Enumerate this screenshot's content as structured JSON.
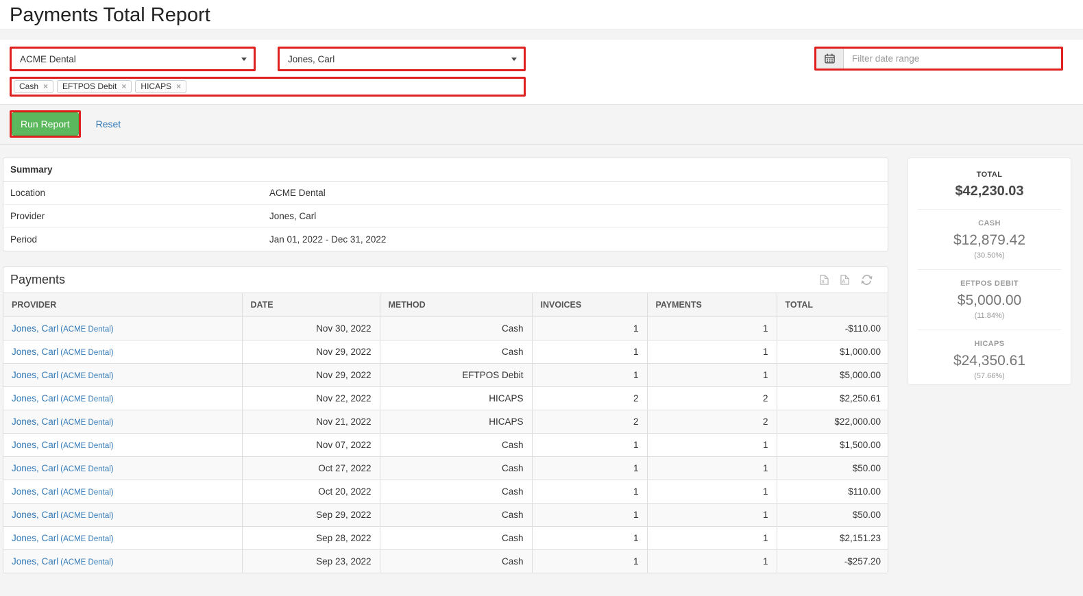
{
  "page": {
    "title": "Payments Total Report"
  },
  "colors": {
    "annotation_red": "#e0201f",
    "run_button_green": "#5cb85c",
    "link_blue": "#337ab7"
  },
  "filters": {
    "location_select": {
      "value": "ACME Dental"
    },
    "provider_select": {
      "value": "Jones, Carl"
    },
    "date": {
      "placeholder": "Filter date range"
    },
    "methods": [
      "Cash",
      "EFTPOS Debit",
      "HICAPS"
    ],
    "remove_glyph": "×",
    "run_label": "Run Report",
    "reset_label": "Reset"
  },
  "summary": {
    "heading": "Summary",
    "rows": [
      {
        "label": "Location",
        "value": "ACME Dental"
      },
      {
        "label": "Provider",
        "value": "Jones, Carl"
      },
      {
        "label": "Period",
        "value": "Jan 01, 2022 - Dec 31, 2022"
      }
    ]
  },
  "payments": {
    "heading": "Payments",
    "columns": [
      "PROVIDER",
      "DATE",
      "METHOD",
      "INVOICES",
      "PAYMENTS",
      "TOTAL"
    ],
    "rows": [
      {
        "provider": "Jones, Carl",
        "location": "(ACME Dental)",
        "date": "Nov 30, 2022",
        "method": "Cash",
        "invoices": "1",
        "payments": "1",
        "total": "-$110.00"
      },
      {
        "provider": "Jones, Carl",
        "location": "(ACME Dental)",
        "date": "Nov 29, 2022",
        "method": "Cash",
        "invoices": "1",
        "payments": "1",
        "total": "$1,000.00"
      },
      {
        "provider": "Jones, Carl",
        "location": "(ACME Dental)",
        "date": "Nov 29, 2022",
        "method": "EFTPOS Debit",
        "invoices": "1",
        "payments": "1",
        "total": "$5,000.00"
      },
      {
        "provider": "Jones, Carl",
        "location": "(ACME Dental)",
        "date": "Nov 22, 2022",
        "method": "HICAPS",
        "invoices": "2",
        "payments": "2",
        "total": "$2,250.61"
      },
      {
        "provider": "Jones, Carl",
        "location": "(ACME Dental)",
        "date": "Nov 21, 2022",
        "method": "HICAPS",
        "invoices": "2",
        "payments": "2",
        "total": "$22,000.00"
      },
      {
        "provider": "Jones, Carl",
        "location": "(ACME Dental)",
        "date": "Nov 07, 2022",
        "method": "Cash",
        "invoices": "1",
        "payments": "1",
        "total": "$1,500.00"
      },
      {
        "provider": "Jones, Carl",
        "location": "(ACME Dental)",
        "date": "Oct 27, 2022",
        "method": "Cash",
        "invoices": "1",
        "payments": "1",
        "total": "$50.00"
      },
      {
        "provider": "Jones, Carl",
        "location": "(ACME Dental)",
        "date": "Oct 20, 2022",
        "method": "Cash",
        "invoices": "1",
        "payments": "1",
        "total": "$110.00"
      },
      {
        "provider": "Jones, Carl",
        "location": "(ACME Dental)",
        "date": "Sep 29, 2022",
        "method": "Cash",
        "invoices": "1",
        "payments": "1",
        "total": "$50.00"
      },
      {
        "provider": "Jones, Carl",
        "location": "(ACME Dental)",
        "date": "Sep 28, 2022",
        "method": "Cash",
        "invoices": "1",
        "payments": "1",
        "total": "$2,151.23"
      },
      {
        "provider": "Jones, Carl",
        "location": "(ACME Dental)",
        "date": "Sep 23, 2022",
        "method": "Cash",
        "invoices": "1",
        "payments": "1",
        "total": "-$257.20"
      }
    ]
  },
  "totals": {
    "sections": [
      {
        "label": "TOTAL",
        "amount": "$42,230.03"
      },
      {
        "label": "CASH",
        "amount": "$12,879.42",
        "pct": "(30.50%)"
      },
      {
        "label": "EFTPOS DEBIT",
        "amount": "$5,000.00",
        "pct": "(11.84%)"
      },
      {
        "label": "HICAPS",
        "amount": "$24,350.61",
        "pct": "(57.66%)"
      }
    ]
  }
}
